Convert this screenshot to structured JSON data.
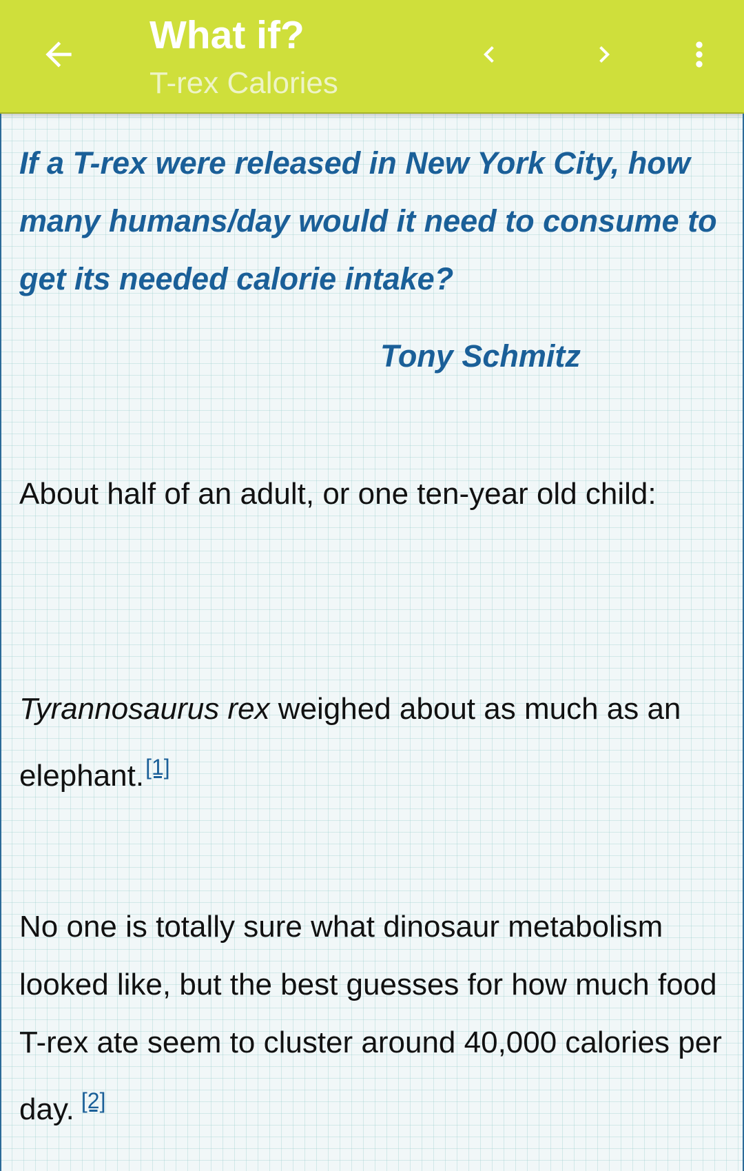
{
  "appbar": {
    "title": "What if?",
    "subtitle": "T-rex Calories",
    "back_icon": "arrow-left-icon",
    "prev_icon": "chevron-left-icon",
    "next_icon": "chevron-right-icon",
    "menu_icon": "more-vertical-icon",
    "background_color": "#cfdf3b"
  },
  "article": {
    "question": "If a T-rex were released in New York City, how many humans/day would it need to consume to get its needed calorie intake?",
    "asker": "Tony Schmitz",
    "paragraph1": "About half of an adult, or one ten-year old child:",
    "paragraph2": {
      "italic": "Tyrannosaurus rex",
      "text": " weighed about as much as an elephant.",
      "ref": "[1]"
    },
    "paragraph3": {
      "text": "No one is totally sure what dinosaur metabolism looked like, but the best guesses for how much food T-rex ate seem to cluster around 40,000 calories per day.",
      "ref": "[2]"
    },
    "accent_color": "#1a5f98"
  }
}
